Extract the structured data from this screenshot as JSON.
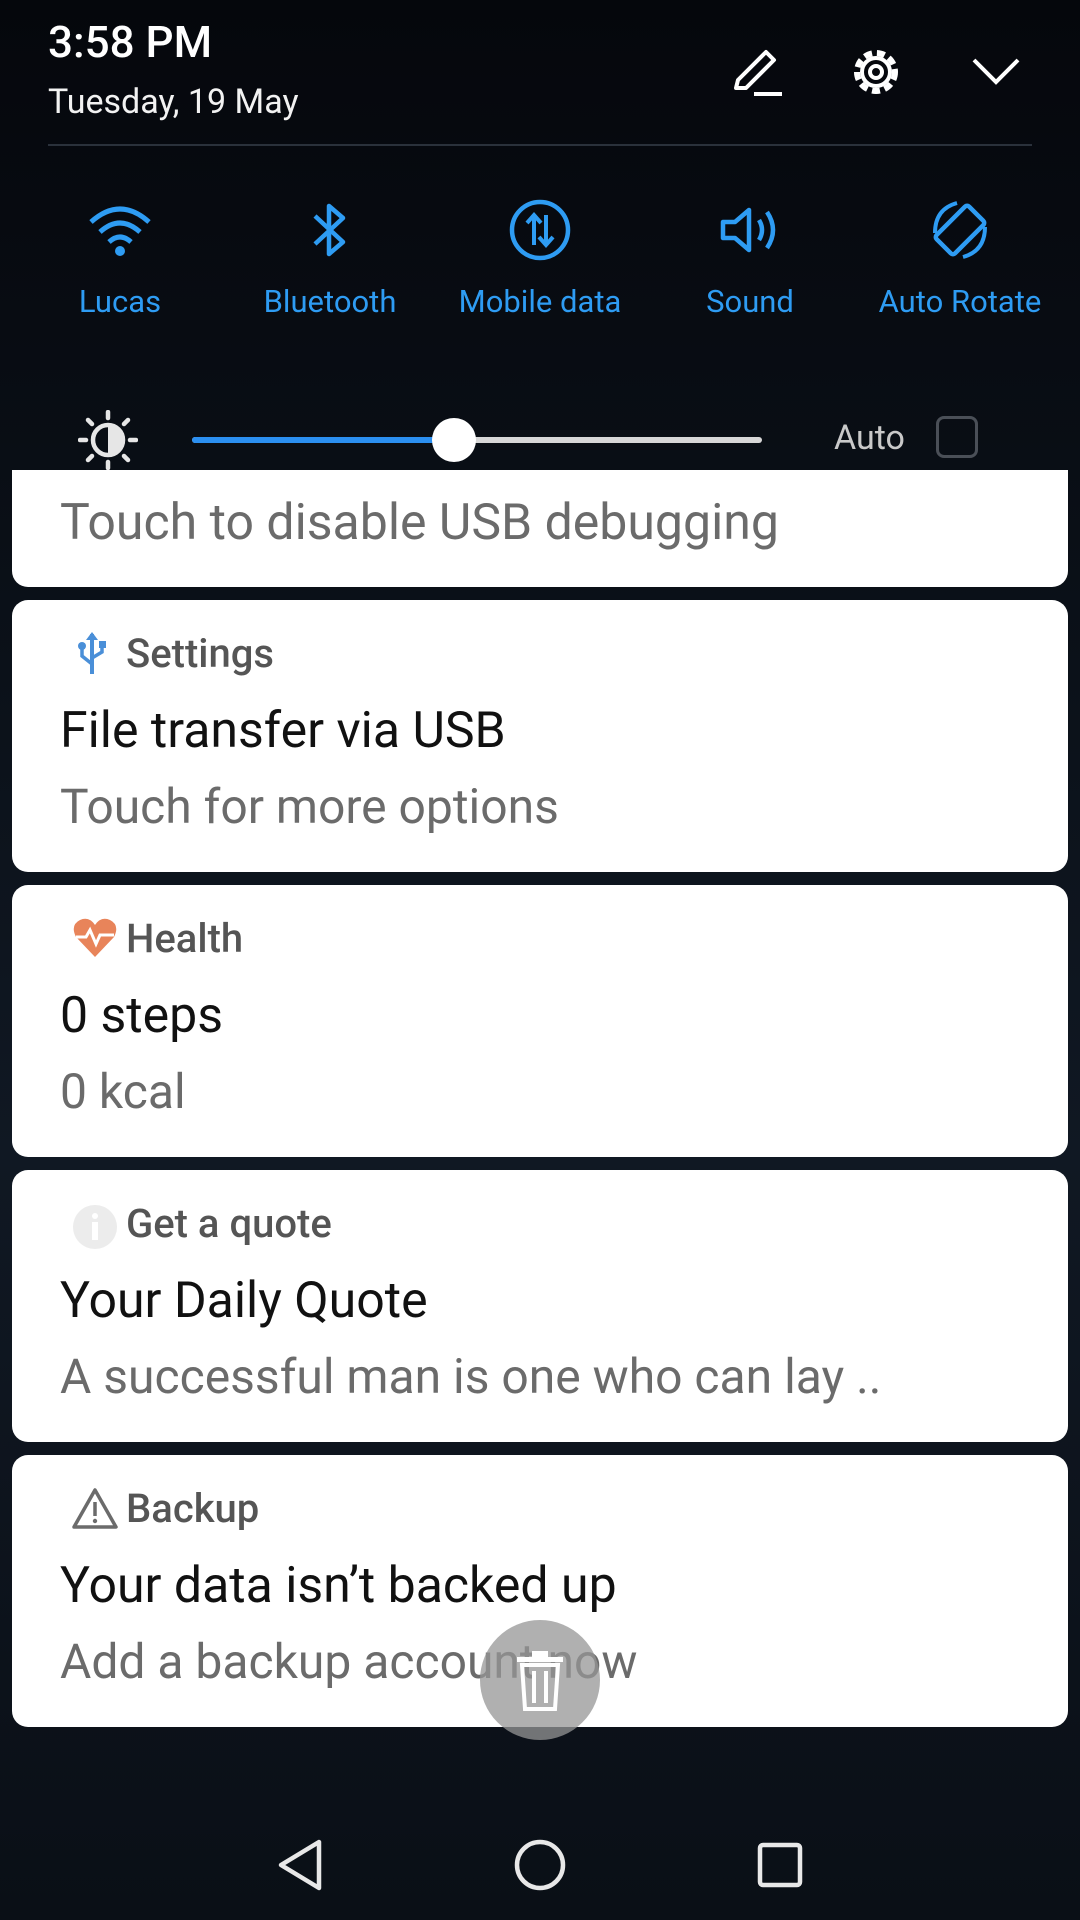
{
  "header": {
    "time": "3:58 PM",
    "date": "Tuesday, 19 May",
    "icons": [
      "edit-icon",
      "settings-gear-icon",
      "collapse-chevron-icon"
    ]
  },
  "toggles": [
    {
      "label": "Lucas",
      "icon": "wifi-icon"
    },
    {
      "label": "Bluetooth",
      "icon": "bluetooth-icon"
    },
    {
      "label": "Mobile data",
      "icon": "mobile-data-icon"
    },
    {
      "label": "Sound",
      "icon": "sound-icon"
    },
    {
      "label": "Auto Rotate",
      "icon": "auto-rotate-icon"
    }
  ],
  "brightness": {
    "level": 0.46,
    "auto_label": "Auto",
    "auto_checked": false
  },
  "notifications": [
    {
      "body": "Touch to disable USB debugging"
    },
    {
      "app": "Settings",
      "app_icon": "usb-icon",
      "title": "File transfer via USB",
      "body": "Touch for more options"
    },
    {
      "app": "Health",
      "app_icon": "heart-rate-icon",
      "title": "0 steps",
      "body": "0 kcal"
    },
    {
      "app": "Get a quote",
      "app_icon": "info-icon",
      "title": "Your Daily Quote",
      "body": "A successful man is one who can lay .."
    },
    {
      "app": "Backup",
      "app_icon": "warning-icon",
      "title": "Your data isn’t backed up",
      "body": "Add a backup account now"
    }
  ],
  "colors": {
    "accent": "#2e9cf3",
    "health": "#e8845a"
  },
  "nav": [
    "back-icon",
    "home-icon",
    "recents-icon"
  ]
}
